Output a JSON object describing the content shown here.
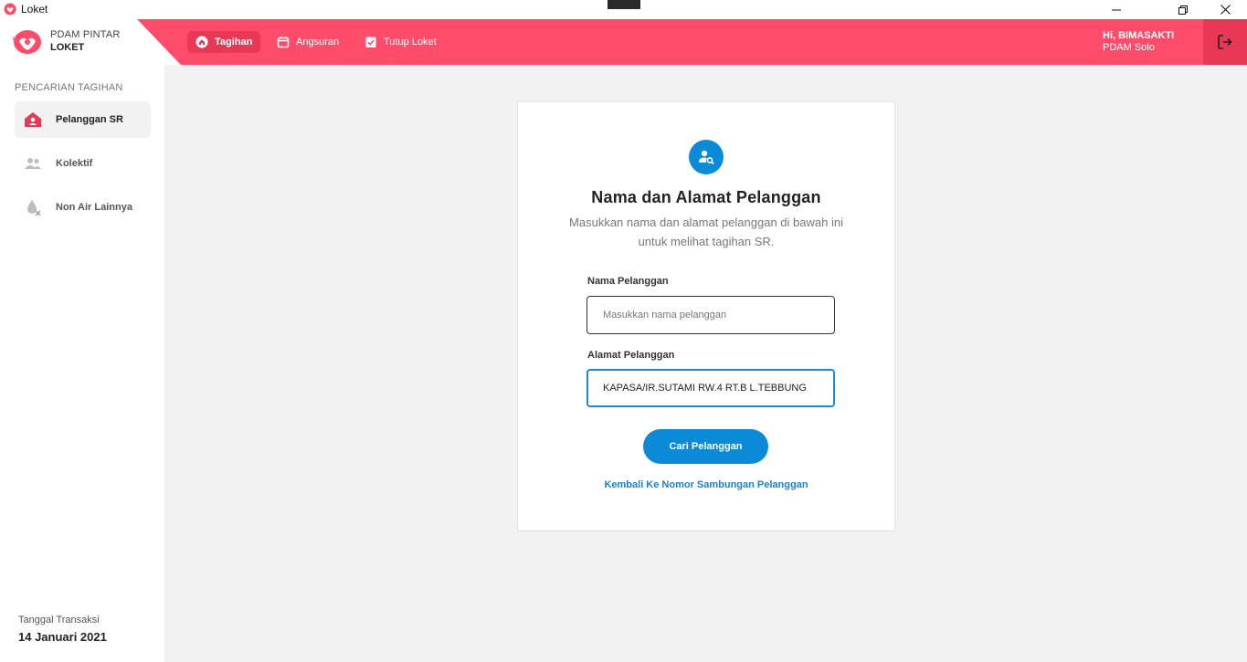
{
  "window": {
    "title": "Loket"
  },
  "brand": {
    "line1": "PDAM PINTAR",
    "line2": "LOKET"
  },
  "nav": {
    "items": [
      {
        "label": "Tagihan",
        "icon": "home-icon",
        "active": true
      },
      {
        "label": "Angsuran",
        "icon": "calendar-icon",
        "active": false
      },
      {
        "label": "Tutup Loket",
        "icon": "clipboard-check-icon",
        "active": false
      }
    ]
  },
  "user": {
    "greeting": "Hi, BIMASAKTI",
    "org": "PDAM Solo"
  },
  "sidebar": {
    "section_title": "PENCARIAN TAGIHAN",
    "items": [
      {
        "label": "Pelanggan SR",
        "icon": "house-user-icon",
        "active": true
      },
      {
        "label": "Kolektif",
        "icon": "users-icon",
        "active": false
      },
      {
        "label": "Non Air Lainnya",
        "icon": "water-drop-x-icon",
        "active": false
      }
    ],
    "transaction_label": "Tanggal Transaksi",
    "transaction_date": "14 Januari 2021"
  },
  "form": {
    "icon": "user-search-icon",
    "title": "Nama dan Alamat Pelanggan",
    "subtitle": "Masukkan nama dan alamat pelanggan di bawah ini untuk melihat tagihan SR.",
    "name_label": "Nama Pelanggan",
    "name_placeholder": "Masukkan nama pelanggan",
    "name_value": "",
    "address_label": "Alamat Pelanggan",
    "address_value": "KAPASA/IR.SUTAMI RW.4 RT.B L.TEBBUNG",
    "submit_label": "Cari Pelanggan",
    "back_link": "Kembali Ke Nomor Sambungan Pelanggan"
  },
  "colors": {
    "brand": "#ff4c6a",
    "brand_dark": "#e83856",
    "primary": "#0b8ad8",
    "link": "#1e7fd0"
  }
}
